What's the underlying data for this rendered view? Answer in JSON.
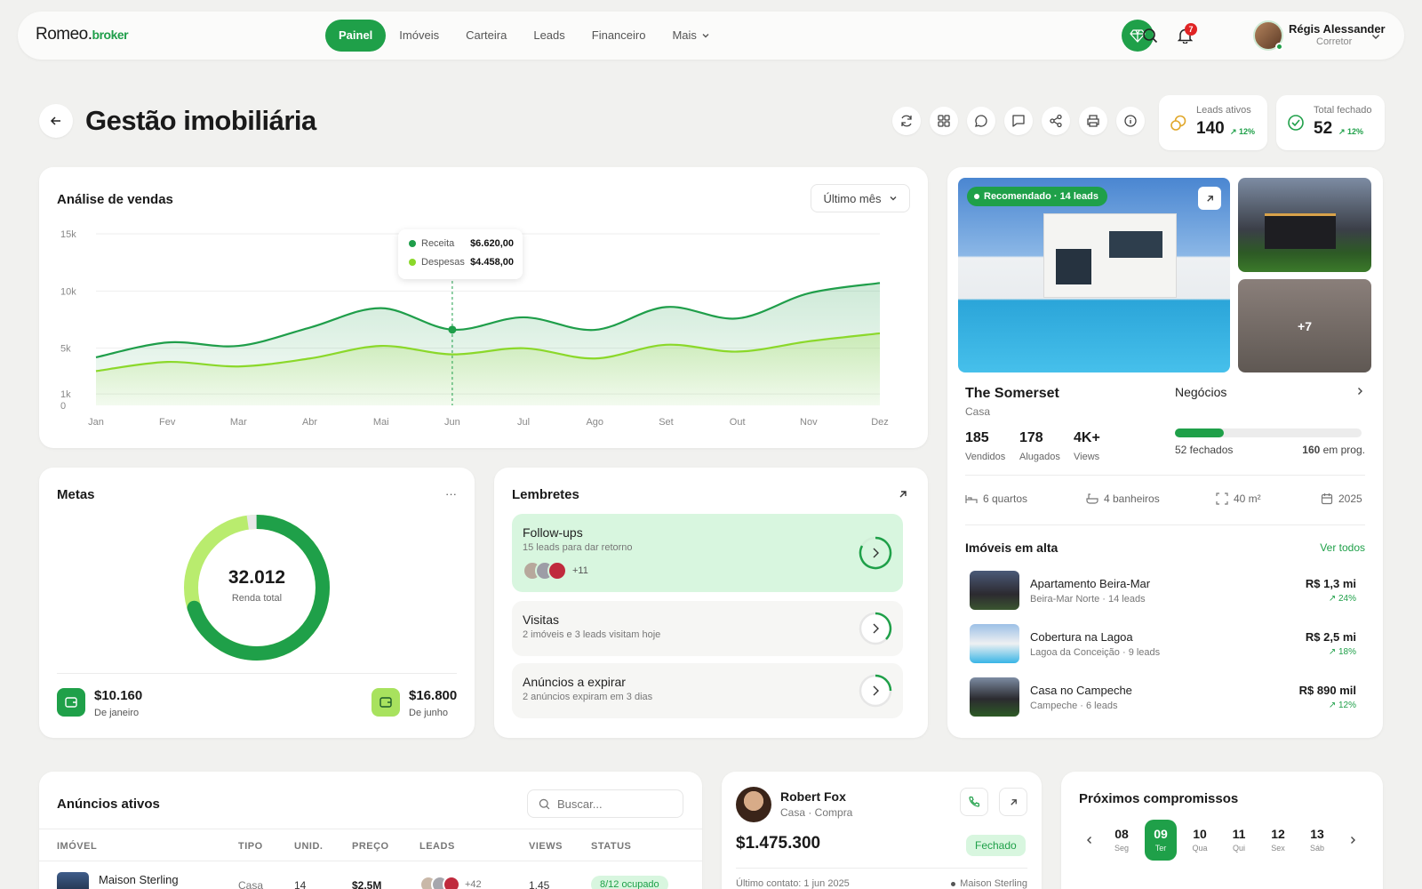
{
  "logo": {
    "main": "Romeo.",
    "accent": "broker"
  },
  "nav": [
    {
      "label": "Painel"
    },
    {
      "label": "Imóveis"
    },
    {
      "label": "Carteira"
    },
    {
      "label": "Leads"
    },
    {
      "label": "Financeiro"
    },
    {
      "label": "Mais"
    }
  ],
  "user": {
    "name": "Régis Alessander",
    "role": "Corretor",
    "notifications": "7"
  },
  "page": {
    "title": "Gestão imobiliária"
  },
  "stats": [
    {
      "label": "Leads ativos",
      "value": "140",
      "trend": "12%"
    },
    {
      "label": "Total fechado",
      "value": "52",
      "trend": "12%"
    }
  ],
  "sales": {
    "title": "Análise de vendas",
    "filter": "Último mês",
    "tooltip": {
      "r_label": "Receita",
      "r_value": "$6.620,00",
      "d_label": "Despesas",
      "d_value": "$4.458,00"
    }
  },
  "chart_data": {
    "type": "area",
    "categories": [
      "Jan",
      "Fev",
      "Mar",
      "Abr",
      "Mai",
      "Jun",
      "Jul",
      "Ago",
      "Set",
      "Out",
      "Nov",
      "Dez"
    ],
    "yticks": [
      "15k",
      "10k",
      "5k",
      "1k",
      "0"
    ],
    "series": [
      {
        "name": "Receita",
        "values": [
          4200,
          5500,
          5200,
          6800,
          8500,
          6620,
          7700,
          6600,
          8600,
          7600,
          9800,
          10700
        ]
      },
      {
        "name": "Despesas",
        "values": [
          3000,
          3800,
          3400,
          4100,
          5200,
          4458,
          5000,
          4100,
          5300,
          4700,
          5600,
          6300
        ]
      }
    ],
    "colors": {
      "receita": "#1f9e4a",
      "despesas": "#8bd82a"
    }
  },
  "goals": {
    "title": "Metas",
    "more": "···",
    "total": "32.012",
    "total_label": "Renda total",
    "progress": 0.7,
    "a_value": "$10.160",
    "a_label": "De janeiro",
    "b_value": "$16.800",
    "b_label": "De junho"
  },
  "reminders": {
    "title": "Lembretes",
    "items": [
      {
        "title": "Follow-ups",
        "sub": "15 leads para dar retorno",
        "extra": "+11"
      },
      {
        "title": "Visitas",
        "sub": "2 imóveis e 3 leads visitam hoje"
      },
      {
        "title": "Anúncios a expirar",
        "sub": "2 anúncios expiram em 3 dias"
      }
    ]
  },
  "property": {
    "badge": "Recomendado · 14 leads",
    "more": "+7",
    "name": "The Somerset",
    "type": "Casa",
    "metrics": [
      {
        "v": "185",
        "l": "Vendidos"
      },
      {
        "v": "178",
        "l": "Alugados"
      },
      {
        "v": "4K+",
        "l": "Views"
      }
    ],
    "deals": {
      "title": "Negócios",
      "closed": "52 fechados",
      "in_progress": "160",
      "in_progress_label": " em prog.",
      "fill": 0.26
    },
    "features": [
      "6 quartos",
      "4 banheiros",
      "40 m²",
      "2025"
    ]
  },
  "trending": {
    "title": "Imóveis em alta",
    "link": "Ver todos",
    "items": [
      {
        "name": "Apartamento Beira-Mar",
        "sub": "Beira-Mar Norte · 14 leads",
        "price": "R$ 1,3 mi",
        "trend": "24%"
      },
      {
        "name": "Cobertura na Lagoa",
        "sub": "Lagoa da Conceição · 9 leads",
        "price": "R$ 2,5 mi",
        "trend": "18%"
      },
      {
        "name": "Casa no Campeche",
        "sub": "Campeche · 6 leads",
        "price": "R$ 890 mil",
        "trend": "12%"
      }
    ]
  },
  "listings": {
    "title": "Anúncios ativos",
    "search_placeholder": "Buscar...",
    "headers": [
      "IMÓVEL",
      "TIPO",
      "UNID.",
      "PREÇO",
      "LEADS",
      "VIEWS",
      "STATUS"
    ],
    "row": {
      "name": "Maison Sterling",
      "type": "Casa",
      "unit": "14",
      "price": "$2,5M",
      "leads": "+42",
      "views": "1,45",
      "status": "8/12 ocupado"
    }
  },
  "lead": {
    "name": "Robert Fox",
    "sub": "Casa · Compra",
    "value": "$1.475.300",
    "status": "Fechado",
    "last": "Último contato: 1 jun 2025",
    "prop": "Maison Sterling"
  },
  "agenda": {
    "title": "Próximos compromissos",
    "days": [
      {
        "n": "08",
        "w": "Seg"
      },
      {
        "n": "09",
        "w": "Ter"
      },
      {
        "n": "10",
        "w": "Qua"
      },
      {
        "n": "11",
        "w": "Qui"
      },
      {
        "n": "12",
        "w": "Sex"
      },
      {
        "n": "13",
        "w": "Sáb"
      }
    ]
  }
}
